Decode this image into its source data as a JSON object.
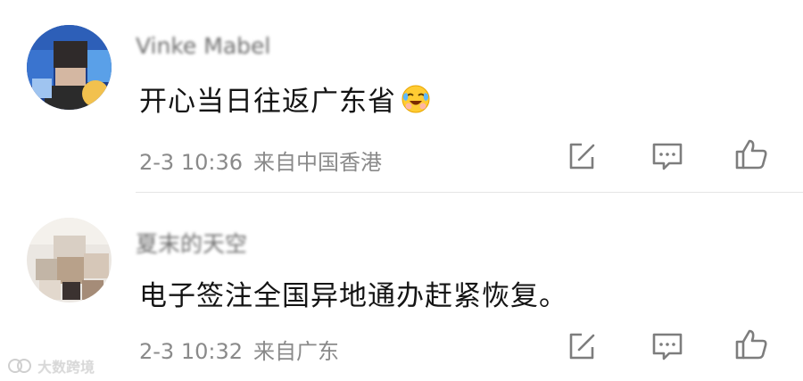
{
  "comments": [
    {
      "username": "Vinke Mabel",
      "text": "开心当日往返广东省",
      "emoji": "crying-laughing-face-icon",
      "time": "2-3 10:36",
      "location": "来自中国香港",
      "actions": [
        "share-icon",
        "reply-icon",
        "like-icon"
      ]
    },
    {
      "username": "夏末的天空",
      "text": "电子签注全国异地通办赶紧恢复。",
      "time": "2-3 10:32",
      "location": "来自广东",
      "actions": [
        "share-icon",
        "reply-icon",
        "like-icon"
      ]
    }
  ],
  "watermark": {
    "text": "大数跨境"
  },
  "colors": {
    "username": "#6f6f6f",
    "meta": "#8a8a8a",
    "divider": "#e5e5e5",
    "icon": "#7d7d7d"
  }
}
